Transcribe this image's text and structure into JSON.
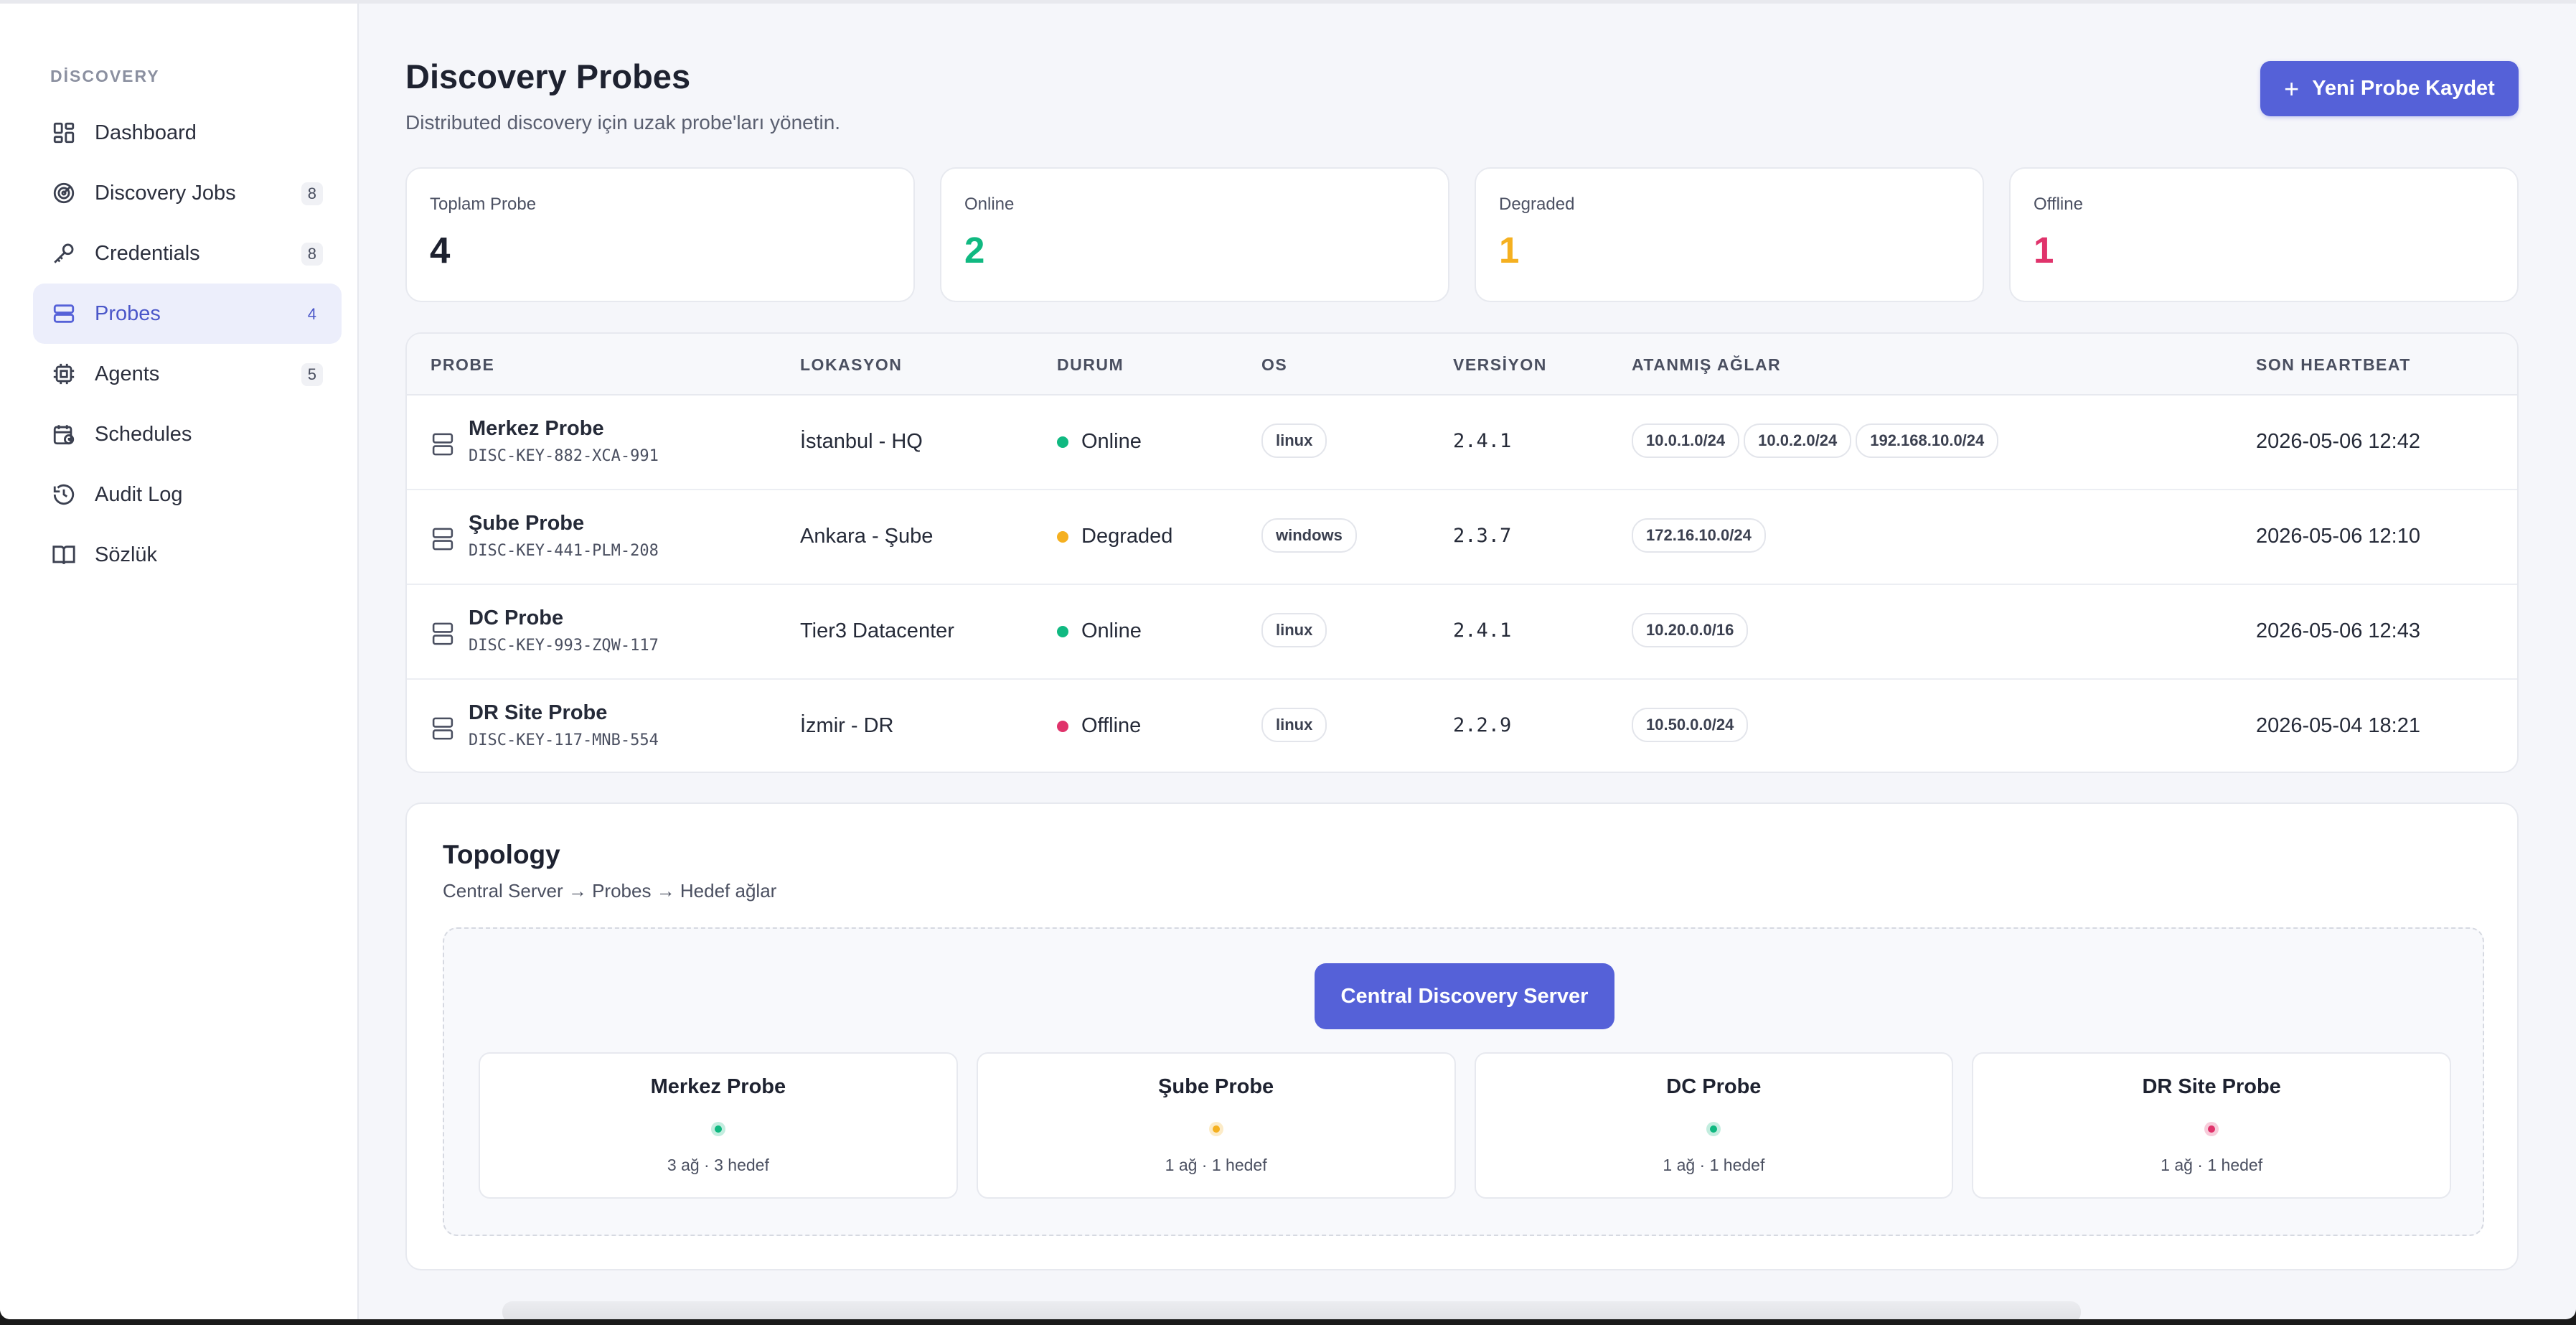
{
  "sidebar": {
    "section": "DİSCOVERY",
    "items": [
      {
        "label": "Dashboard",
        "count": "",
        "icon": "dashboard-icon"
      },
      {
        "label": "Discovery Jobs",
        "count": "8",
        "icon": "radar-icon"
      },
      {
        "label": "Credentials",
        "count": "8",
        "icon": "key-icon"
      },
      {
        "label": "Probes",
        "count": "4",
        "icon": "server-icon"
      },
      {
        "label": "Agents",
        "count": "5",
        "icon": "cpu-icon"
      },
      {
        "label": "Schedules",
        "count": "",
        "icon": "calendar-icon"
      },
      {
        "label": "Audit Log",
        "count": "",
        "icon": "history-icon"
      },
      {
        "label": "Sözlük",
        "count": "",
        "icon": "book-icon"
      }
    ]
  },
  "header": {
    "title": "Discovery Probes",
    "subtitle": "Distributed discovery için uzak probe'ları yönetin.",
    "new_button": "Yeni Probe Kaydet"
  },
  "stats": [
    {
      "label": "Toplam Probe",
      "value": "4",
      "color": "#1e2230"
    },
    {
      "label": "Online",
      "value": "2",
      "color": "#10b981"
    },
    {
      "label": "Degraded",
      "value": "1",
      "color": "#f5b020"
    },
    {
      "label": "Offline",
      "value": "1",
      "color": "#e0336b"
    }
  ],
  "table": {
    "headers": {
      "probe": "PROBE",
      "location": "LOKASYON",
      "status": "DURUM",
      "os": "OS",
      "version": "VERSİYON",
      "networks": "ATANMIŞ AĞLAR",
      "heartbeat": "SON HEARTBEAT"
    },
    "rows": [
      {
        "name": "Merkez Probe",
        "key": "DISC-KEY-882-XCA-991",
        "location": "İstanbul - HQ",
        "status": "Online",
        "status_color": "#10b981",
        "os": "linux",
        "version": "2.4.1",
        "networks": [
          "10.0.1.0/24",
          "10.0.2.0/24",
          "192.168.10.0/24"
        ],
        "heartbeat": "2026-05-06 12:42"
      },
      {
        "name": "Şube Probe",
        "key": "DISC-KEY-441-PLM-208",
        "location": "Ankara - Şube",
        "status": "Degraded",
        "status_color": "#f5b020",
        "os": "windows",
        "version": "2.3.7",
        "networks": [
          "172.16.10.0/24"
        ],
        "heartbeat": "2026-05-06 12:10"
      },
      {
        "name": "DC Probe",
        "key": "DISC-KEY-993-ZQW-117",
        "location": "Tier3 Datacenter",
        "status": "Online",
        "status_color": "#10b981",
        "os": "linux",
        "version": "2.4.1",
        "networks": [
          "10.20.0.0/16"
        ],
        "heartbeat": "2026-05-06 12:43"
      },
      {
        "name": "DR Site Probe",
        "key": "DISC-KEY-117-MNB-554",
        "location": "İzmir - DR",
        "status": "Offline",
        "status_color": "#e0336b",
        "os": "linux",
        "version": "2.2.9",
        "networks": [
          "10.50.0.0/24"
        ],
        "heartbeat": "2026-05-04 18:21"
      }
    ]
  },
  "topology": {
    "title": "Topology",
    "subtitle": "Central Server → Probes → Hedef ağlar",
    "server_label": "Central Discovery Server",
    "probes": [
      {
        "name": "Merkez Probe",
        "info": "3 ağ · 3 hedef",
        "color": "#10b981"
      },
      {
        "name": "Şube Probe",
        "info": "1 ağ · 1 hedef",
        "color": "#f5b020"
      },
      {
        "name": "DC Probe",
        "info": "1 ağ · 1 hedef",
        "color": "#10b981"
      },
      {
        "name": "DR Site Probe",
        "info": "1 ağ · 1 hedef",
        "color": "#e0336b"
      }
    ]
  },
  "colors": {
    "accent": "#5561d8",
    "online": "#10b981",
    "degraded": "#f5b020",
    "offline": "#e0336b"
  }
}
